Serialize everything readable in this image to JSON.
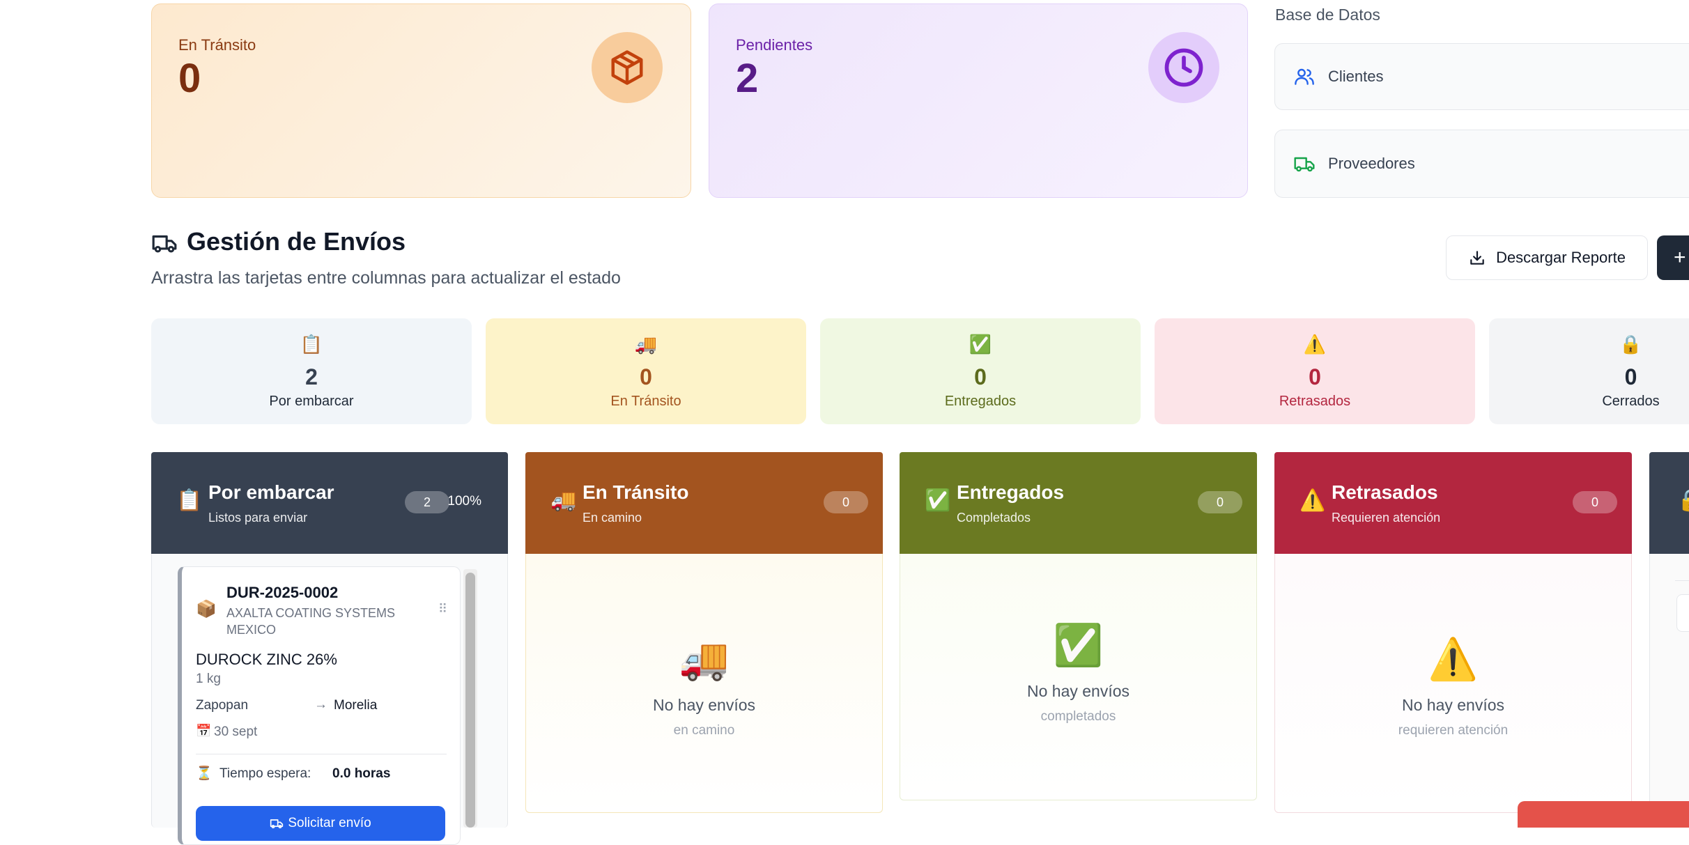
{
  "stats": {
    "transit": {
      "label": "En Tránsito",
      "value": "0",
      "icon": "box-icon"
    },
    "pending": {
      "label": "Pendientes",
      "value": "2",
      "icon": "clock-icon"
    }
  },
  "database": {
    "title": "Base de Datos",
    "clients": {
      "label": "Clientes",
      "icon": "users-icon"
    },
    "suppliers": {
      "label": "Proveedores",
      "icon": "truck-icon"
    }
  },
  "header": {
    "title": "Gestión de Envíos",
    "subtitle": "Arrastra las tarjetas entre columnas para actualizar el estado",
    "download_label": "Descargar Reporte",
    "add_label": "+"
  },
  "summary": [
    {
      "emoji": "📋",
      "value": "2",
      "label": "Por embarcar"
    },
    {
      "emoji": "🚚",
      "value": "0",
      "label": "En Tránsito"
    },
    {
      "emoji": "✅",
      "value": "0",
      "label": "Entregados"
    },
    {
      "emoji": "⚠️",
      "value": "0",
      "label": "Retrasados"
    },
    {
      "emoji": "🔒",
      "value": "0",
      "label": "Cerrados"
    }
  ],
  "columns": [
    {
      "emoji": "📋",
      "title": "Por embarcar",
      "subtitle": "Listos para enviar",
      "count": "2",
      "percent": "100%",
      "color": "#374151"
    },
    {
      "emoji": "🚚",
      "title": "En Tránsito",
      "subtitle": "En camino",
      "count": "0",
      "empty_title": "No hay envíos",
      "empty_sub": "en camino",
      "color": "#a3541f"
    },
    {
      "emoji": "✅",
      "title": "Entregados",
      "subtitle": "Completados",
      "count": "0",
      "empty_title": "No hay envíos",
      "empty_sub": "completados",
      "color": "#6b7a22"
    },
    {
      "emoji": "⚠️",
      "title": "Retrasados",
      "subtitle": "Requieren atención",
      "count": "0",
      "empty_title": "No hay envíos",
      "empty_sub": "requieren atención",
      "color": "#b3263f"
    },
    {
      "emoji": "🔒",
      "color": "#374151"
    }
  ],
  "shipment": {
    "emoji": "📦",
    "code": "DUR-2025-0002",
    "client_line1": "AXALTA COATING SYSTEMS",
    "client_line2": "MEXICO",
    "product": "DUROCK ZINC 26%",
    "weight": "1 kg",
    "origin": "Zapopan",
    "arrow": "→",
    "destination": "Morelia",
    "date_emoji": "📅",
    "date": "30 sept",
    "wait_emoji": "⏳",
    "wait_label": "Tiempo espera:",
    "wait_value": "0.0 horas",
    "request_label": "Solicitar envío",
    "drag_handle": "⠿"
  }
}
